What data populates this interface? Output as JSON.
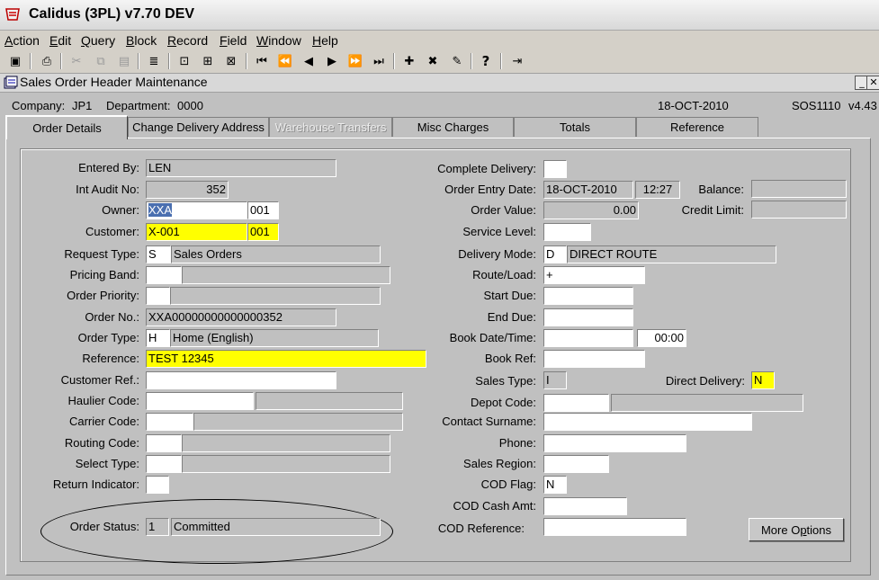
{
  "app": {
    "title": "Calidus (3PL) v7.70 DEV"
  },
  "menu": [
    {
      "label": "Action",
      "key": "A"
    },
    {
      "label": "Edit",
      "key": "E"
    },
    {
      "label": "Query",
      "key": "Q"
    },
    {
      "label": "Block",
      "key": "B"
    },
    {
      "label": "Record",
      "key": "R"
    },
    {
      "label": "Field",
      "key": "F"
    },
    {
      "label": "Window",
      "key": "W"
    },
    {
      "label": "Help",
      "key": "H"
    }
  ],
  "toolbar": [
    {
      "name": "save-icon",
      "glyph": "▣",
      "enabled": true
    },
    {
      "name": "print-icon",
      "glyph": "⎙",
      "enabled": true
    },
    {
      "name": "cut-icon",
      "glyph": "✂",
      "enabled": false
    },
    {
      "name": "copy-icon",
      "glyph": "⧉",
      "enabled": false
    },
    {
      "name": "paste-icon",
      "glyph": "▤",
      "enabled": false
    },
    {
      "name": "list-icon",
      "glyph": "≣",
      "enabled": true
    },
    {
      "name": "enter-query-icon",
      "glyph": "⊡",
      "enabled": true
    },
    {
      "name": "execute-query-icon",
      "glyph": "⊞",
      "enabled": true
    },
    {
      "name": "cancel-query-icon",
      "glyph": "⊠",
      "enabled": true
    },
    {
      "name": "first-record-icon",
      "glyph": "⏮",
      "enabled": true
    },
    {
      "name": "previous-block-icon",
      "glyph": "⏪",
      "enabled": true
    },
    {
      "name": "previous-record-icon",
      "glyph": "◀",
      "enabled": true
    },
    {
      "name": "next-record-icon",
      "glyph": "▶",
      "enabled": true
    },
    {
      "name": "next-block-icon",
      "glyph": "⏩",
      "enabled": true
    },
    {
      "name": "last-record-icon",
      "glyph": "⏭",
      "enabled": true
    },
    {
      "name": "insert-record-icon",
      "glyph": "✚",
      "enabled": true
    },
    {
      "name": "delete-record-icon",
      "glyph": "✖",
      "enabled": true
    },
    {
      "name": "clear-record-icon",
      "glyph": "✎",
      "enabled": true
    },
    {
      "name": "help-icon",
      "glyph": "?",
      "enabled": true
    },
    {
      "name": "exit-icon",
      "glyph": "⇥",
      "enabled": true
    }
  ],
  "window": {
    "title": "Sales Order Header Maintenance"
  },
  "info": {
    "company_label": "Company:",
    "company": "JP1",
    "department_label": "Department:",
    "department": "0000",
    "date": "18-OCT-2010",
    "form_id": "SOS1110",
    "version": "v4.43"
  },
  "tabs": [
    {
      "label": "Order Details",
      "active": true,
      "enabled": true
    },
    {
      "label": "Change Delivery Address",
      "active": false,
      "enabled": true
    },
    {
      "label": "Warehouse Transfers",
      "active": false,
      "enabled": false
    },
    {
      "label": "Misc Charges",
      "active": false,
      "enabled": true
    },
    {
      "label": "Totals",
      "active": false,
      "enabled": true
    },
    {
      "label": "Reference",
      "active": false,
      "enabled": true
    }
  ],
  "form": {
    "entered_by": {
      "label": "Entered By:",
      "value": "LEN"
    },
    "int_audit_no": {
      "label": "Int Audit No:",
      "value": "352"
    },
    "owner": {
      "label": "Owner:",
      "value": "XXA",
      "sub": "001"
    },
    "customer": {
      "label": "Customer:",
      "value": "X-001",
      "sub": "001"
    },
    "request_type": {
      "label": "Request Type:",
      "code": "S",
      "desc": "Sales Orders"
    },
    "pricing_band": {
      "label": "Pricing Band:",
      "code": "",
      "desc": ""
    },
    "order_priority": {
      "label": "Order Priority:",
      "code": "",
      "desc": ""
    },
    "order_no": {
      "label": "Order No.:",
      "value": "XXA00000000000000352"
    },
    "order_type": {
      "label": "Order Type:",
      "code": "H",
      "desc": "Home (English)"
    },
    "reference": {
      "label": "Reference:",
      "value": "TEST 12345"
    },
    "customer_ref": {
      "label": "Customer Ref.:",
      "value": ""
    },
    "haulier_code": {
      "label": "Haulier Code:",
      "code": "",
      "desc": ""
    },
    "carrier_code": {
      "label": "Carrier Code:",
      "code": "",
      "desc": ""
    },
    "routing_code": {
      "label": "Routing Code:",
      "code": "",
      "desc": ""
    },
    "select_type": {
      "label": "Select Type:",
      "code": "",
      "desc": ""
    },
    "return_indicator": {
      "label": "Return Indicator:",
      "value": ""
    },
    "order_status": {
      "label": "Order Status:",
      "code": "1",
      "desc": "Committed"
    },
    "complete_delivery": {
      "label": "Complete Delivery:",
      "value": ""
    },
    "order_entry_date": {
      "label": "Order Entry Date:",
      "date": "18-OCT-2010",
      "time": "12:27"
    },
    "balance": {
      "label": "Balance:",
      "value": ""
    },
    "order_value": {
      "label": "Order Value:",
      "value": "0.00"
    },
    "credit_limit": {
      "label": "Credit Limit:",
      "value": ""
    },
    "service_level": {
      "label": "Service Level:",
      "value": ""
    },
    "delivery_mode": {
      "label": "Delivery Mode:",
      "code": "D",
      "desc": "DIRECT ROUTE"
    },
    "route_load": {
      "label": "Route/Load:",
      "value": "+"
    },
    "start_due": {
      "label": "Start Due:",
      "value": ""
    },
    "end_due": {
      "label": "End Due:",
      "value": ""
    },
    "book_date_time": {
      "label": "Book Date/Time:",
      "date": "",
      "time": "00:00"
    },
    "book_ref": {
      "label": "Book Ref:",
      "value": ""
    },
    "sales_type": {
      "label": "Sales Type:",
      "value": "I"
    },
    "direct_delivery": {
      "label": "Direct Delivery:",
      "value": "N"
    },
    "depot_code": {
      "label": "Depot Code:",
      "code": "",
      "desc": ""
    },
    "contact_surname": {
      "label": "Contact Surname:",
      "value": ""
    },
    "phone": {
      "label": "Phone:",
      "value": ""
    },
    "sales_region": {
      "label": "Sales Region:",
      "value": ""
    },
    "cod_flag": {
      "label": "COD Flag:",
      "value": "N"
    },
    "cod_cash_amt": {
      "label": "COD Cash Amt:",
      "value": ""
    },
    "cod_reference": {
      "label": "COD Reference:",
      "value": ""
    }
  },
  "more_options": {
    "label": "More Options",
    "key": "p"
  },
  "colors": {
    "background": "#c0c0c0",
    "highlight": "#ffff00",
    "input": "#ffffff"
  }
}
